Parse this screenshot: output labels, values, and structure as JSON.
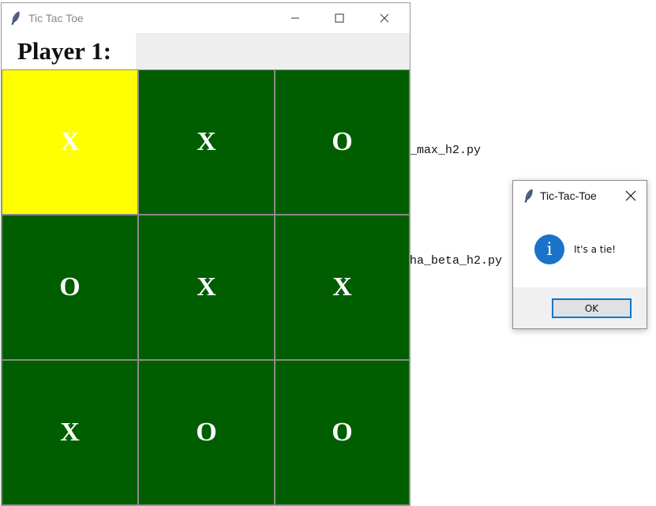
{
  "background": {
    "line1": "_max_h2.py",
    "line2": "ha_beta_h2.py"
  },
  "main_window": {
    "title": "Tic Tac Toe",
    "icon": "feather-icon",
    "controls": {
      "minimize": "minimize-icon",
      "maximize": "maximize-icon",
      "close": "close-icon"
    },
    "player_label": "Player 1:",
    "player_value": "",
    "board": [
      [
        "X",
        "X",
        "O"
      ],
      [
        "O",
        "X",
        "X"
      ],
      [
        "X",
        "O",
        "O"
      ]
    ],
    "highlighted_cell": [
      0,
      0
    ],
    "colors": {
      "cell": "#005e00",
      "highlight": "#ffff00",
      "mark": "#ffffff"
    }
  },
  "dialog": {
    "title": "Tic-Tac-Toe",
    "icon": "feather-icon",
    "info_icon": "information-icon",
    "info_glyph": "i",
    "message": "It's a tie!",
    "ok_label": "OK",
    "accent": "#0078d7"
  }
}
